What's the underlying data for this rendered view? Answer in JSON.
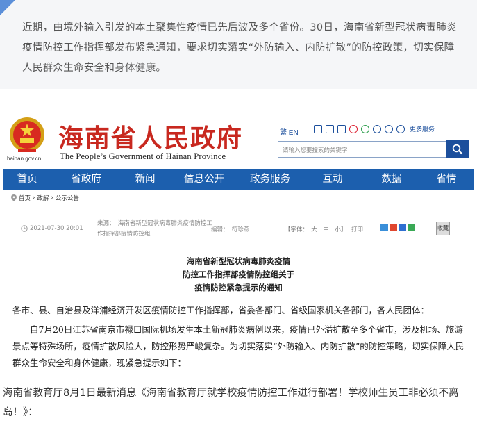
{
  "intro": {
    "text": "近期，由境外输入引发的本土聚集性疫情已先后波及多个省份。30日，海南省新型冠状病毒肺炎疫情防控工作指挥部发布紧急通知，要求切实落实“外防输入、内防扩散”的防控政策，切实保障人民群众生命安全和身体健康。"
  },
  "site": {
    "domain": "hainan.gov.cn",
    "title": "海南省人民政府",
    "subtitle": "The People’s Government of Hainan Province",
    "lang_label": "繁 EN",
    "more_services": "更多服务",
    "search_placeholder": "请输入您要搜索的关键字",
    "nav": [
      "首页",
      "省政府",
      "新闻",
      "信息公开",
      "政务服务",
      "互动",
      "数据",
      "省情"
    ],
    "breadcrumb": [
      "首页",
      "政解",
      "公示公告"
    ],
    "meta": {
      "date": "2021-07-30 20:01",
      "source": "来源：　海南省新型冠状病毒肺炎疫情防控工作指挥部疫情防控组",
      "editor": "编辑：　符珍燕",
      "fontsize": "【字体：　大　中　小】",
      "print": "打印",
      "close": "收藏"
    },
    "notice_title": [
      "海南省新型冠状病毒肺炎疫情",
      "防控工作指挥部疫情防控组关于",
      "疫情防控紧急提示的通知"
    ],
    "addressee": "各市、县、自治县及洋浦经济开发区疫情防控工作指挥部，省委各部门、省级国家机关各部门，各人民团体：",
    "paragraph": "自7月20日江苏省南京市禄口国际机场发生本土新冠肺炎病例以来，疫情已外溢扩散至多个省市，涉及机场、旅游景点等特殊场所，疫情扩散风险大，防控形势严峻复杂。为切实落实“外防输入、内防扩散”的防控策略，切实保障人民群众生命安全和身体健康，现紧急提示如下："
  },
  "bottom": {
    "text": "海南省教育厅8月1日最新消息《海南省教育厅就学校疫情防控工作进行部署！学校师生员工非必须不离岛！》："
  },
  "colors": {
    "title_red": "#c8281f",
    "nav_blue": "#1c5fae",
    "accent_blue": "#5b8fd9"
  }
}
